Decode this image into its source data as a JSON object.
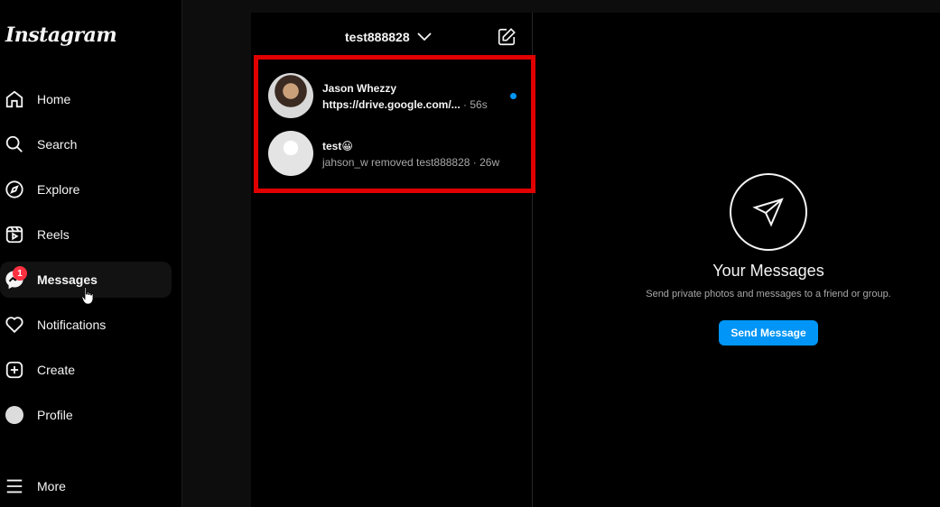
{
  "app": {
    "logo_text": "Instagram"
  },
  "sidebar": {
    "items": [
      {
        "label": "Home",
        "icon": "home-icon"
      },
      {
        "label": "Search",
        "icon": "search-icon"
      },
      {
        "label": "Explore",
        "icon": "compass-icon"
      },
      {
        "label": "Reels",
        "icon": "reels-icon"
      },
      {
        "label": "Messages",
        "icon": "messenger-icon",
        "badge": "1",
        "active": true
      },
      {
        "label": "Notifications",
        "icon": "heart-icon"
      },
      {
        "label": "Create",
        "icon": "plus-square-icon"
      },
      {
        "label": "Profile",
        "icon": "avatar-icon"
      },
      {
        "label": "More",
        "icon": "menu-icon"
      }
    ]
  },
  "inbox": {
    "username": "test888828",
    "conversations": [
      {
        "name": "Jason Whezzy",
        "preview": "https://drive.google.com/...",
        "meta": " · 56s",
        "unread": true
      },
      {
        "name": "test😀",
        "preview": "jahson_w removed test888828",
        "meta": " · 26w",
        "unread": false
      }
    ]
  },
  "empty_state": {
    "title": "Your Messages",
    "subtitle": "Send private photos and messages to a friend or group.",
    "button_label": "Send Message"
  },
  "colors": {
    "background": "#000000",
    "accent": "#0095f6",
    "badge": "#ff3040",
    "highlight": "#e00000"
  }
}
